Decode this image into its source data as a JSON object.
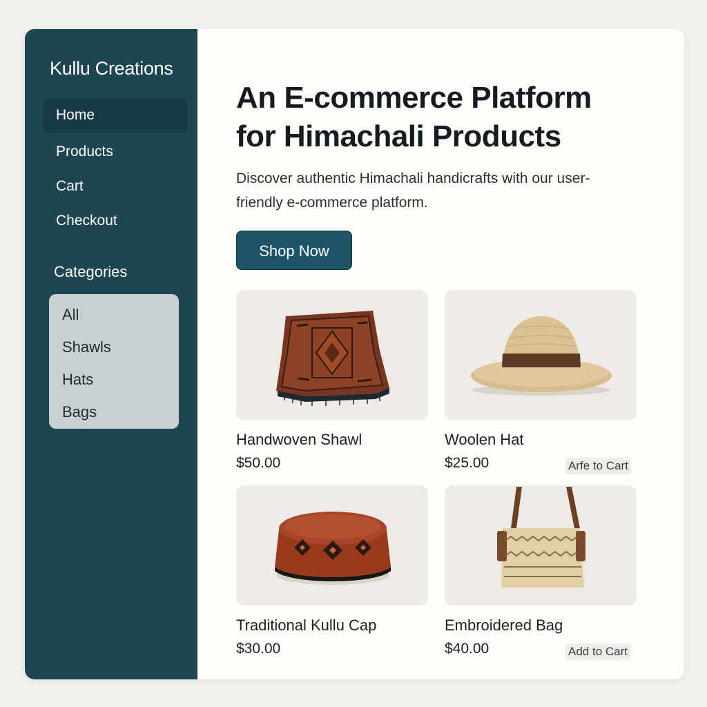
{
  "sidebar": {
    "brand": "Kullu Creations",
    "nav": [
      {
        "label": "Home",
        "active": true
      },
      {
        "label": "Products"
      },
      {
        "label": "Cart"
      },
      {
        "label": "Checkout"
      }
    ],
    "categories_title": "Categories",
    "categories": [
      "All",
      "Shawls",
      "Hats",
      "Bags"
    ]
  },
  "hero": {
    "title": "An E-commerce Platform for Himachali Products",
    "description": "Discover authentic Himachali handicrafts with our user-friendly e-commerce platform.",
    "cta": "Shop Now"
  },
  "products": [
    {
      "name": "Handwoven Shawl",
      "price": "$50.00",
      "image": "shawl"
    },
    {
      "name": "Woolen Hat",
      "price": "$25.00",
      "image": "straw-hat",
      "add_label": "Arfe to Cart"
    },
    {
      "name": "Traditional Kullu Cap",
      "price": "$30.00",
      "image": "kullu-cap"
    },
    {
      "name": "Embroidered Bag",
      "price": "$40.00",
      "image": "woven-bag",
      "add_label": "Add to Cart"
    }
  ],
  "colors": {
    "sidebar": "#1d4552",
    "accent": "#1d5468",
    "card_bg": "#eeebe6",
    "category_bg": "#c9d0d3"
  }
}
